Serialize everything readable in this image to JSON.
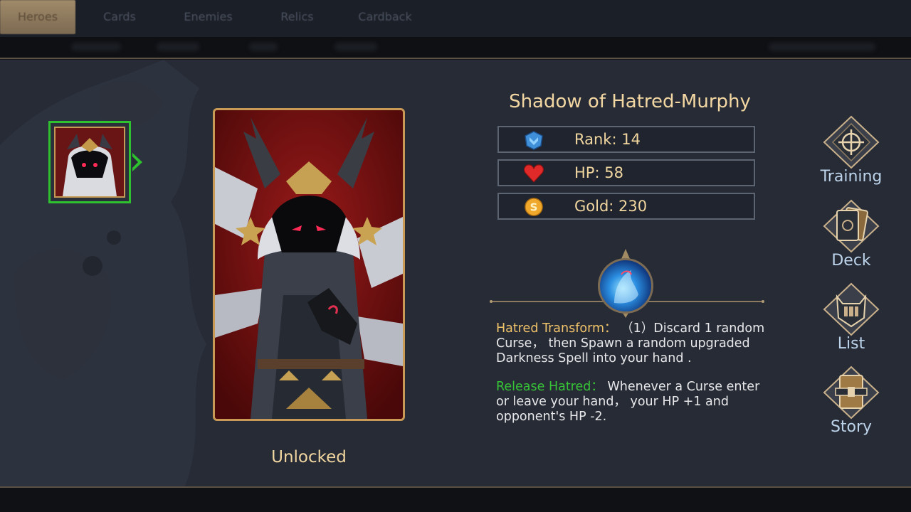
{
  "tabs": [
    {
      "label": "Heroes",
      "active": true
    },
    {
      "label": "Cards",
      "active": false
    },
    {
      "label": "Enemies",
      "active": false
    },
    {
      "label": "Relics",
      "active": false
    },
    {
      "label": "Cardback",
      "active": false
    }
  ],
  "hero": {
    "name": "Shadow of Hatred-Murphy",
    "status": "Unlocked"
  },
  "stats": [
    {
      "label": "Rank: 14",
      "icon": "rank-icon",
      "color": "#3f8fd9"
    },
    {
      "label": "HP: 58",
      "icon": "heart-icon",
      "color": "#e02a2a"
    },
    {
      "label": "Gold: 230",
      "icon": "gold-coin-icon",
      "color": "#f0a82c"
    }
  ],
  "skills": [
    {
      "name": "Hatred Transform：",
      "desc": " （1）Discard 1 random Curse， then Spawn a random upgraded Darkness Spell into your hand ."
    },
    {
      "name": "Release Hatred：",
      "desc": "  Whenever a Curse enter or leave your hand， your HP +1 and opponent's HP -2."
    }
  ],
  "side_menu": [
    {
      "label": "Training",
      "icon": "training-icon"
    },
    {
      "label": "Deck",
      "icon": "deck-icon"
    },
    {
      "label": "List",
      "icon": "list-icon"
    },
    {
      "label": "Story",
      "icon": "story-icon"
    }
  ],
  "colors": {
    "accent_gold": "#f1d6a0",
    "selected_green": "#2ec22e",
    "skill1_name": "#f1c36a",
    "skill2_name": "#37c437"
  }
}
